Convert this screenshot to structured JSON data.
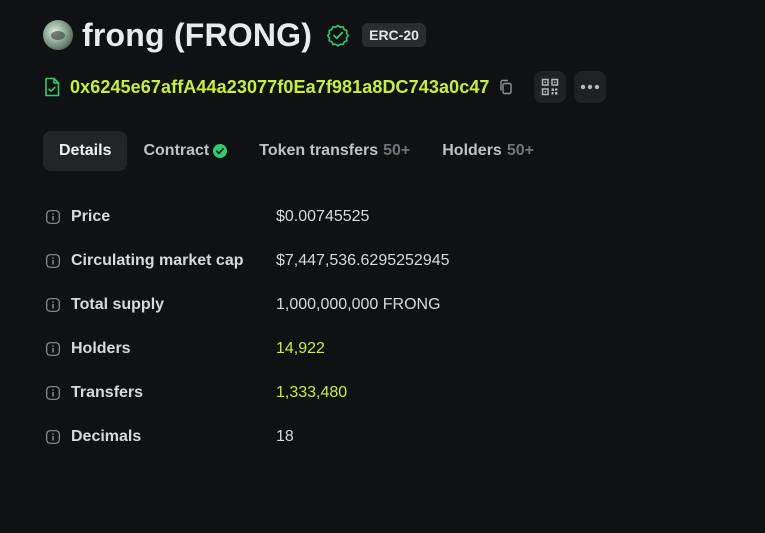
{
  "token": {
    "name": "frong (FRONG)",
    "standard": "ERC-20",
    "address": "0x6245e67affA44a23077f0Ea7f981a8DC743a0c47"
  },
  "tabs": [
    {
      "label": "Details"
    },
    {
      "label": "Contract"
    },
    {
      "label": "Token transfers",
      "count": "50+"
    },
    {
      "label": "Holders",
      "count": "50+"
    }
  ],
  "details": [
    {
      "label": "Price",
      "value": "$0.00745525"
    },
    {
      "label": "Circulating market cap",
      "value": "$7,447,536.6295252945"
    },
    {
      "label": "Total supply",
      "value": "1,000,000,000 FRONG"
    },
    {
      "label": "Holders",
      "value": "14,922"
    },
    {
      "label": "Transfers",
      "value": "1,333,480"
    },
    {
      "label": "Decimals",
      "value": "18"
    }
  ],
  "icons": {
    "avatar": "token-avatar",
    "verified": "verified-shield-icon",
    "file": "contract-file-icon",
    "copy": "copy-icon",
    "qr": "qr-code-icon",
    "more": "more-icon",
    "contract_check": "verified-check-icon",
    "info": "info-icon"
  },
  "colors": {
    "accent": "#c6f135",
    "verified": "#2ecc71",
    "background": "#101112"
  }
}
